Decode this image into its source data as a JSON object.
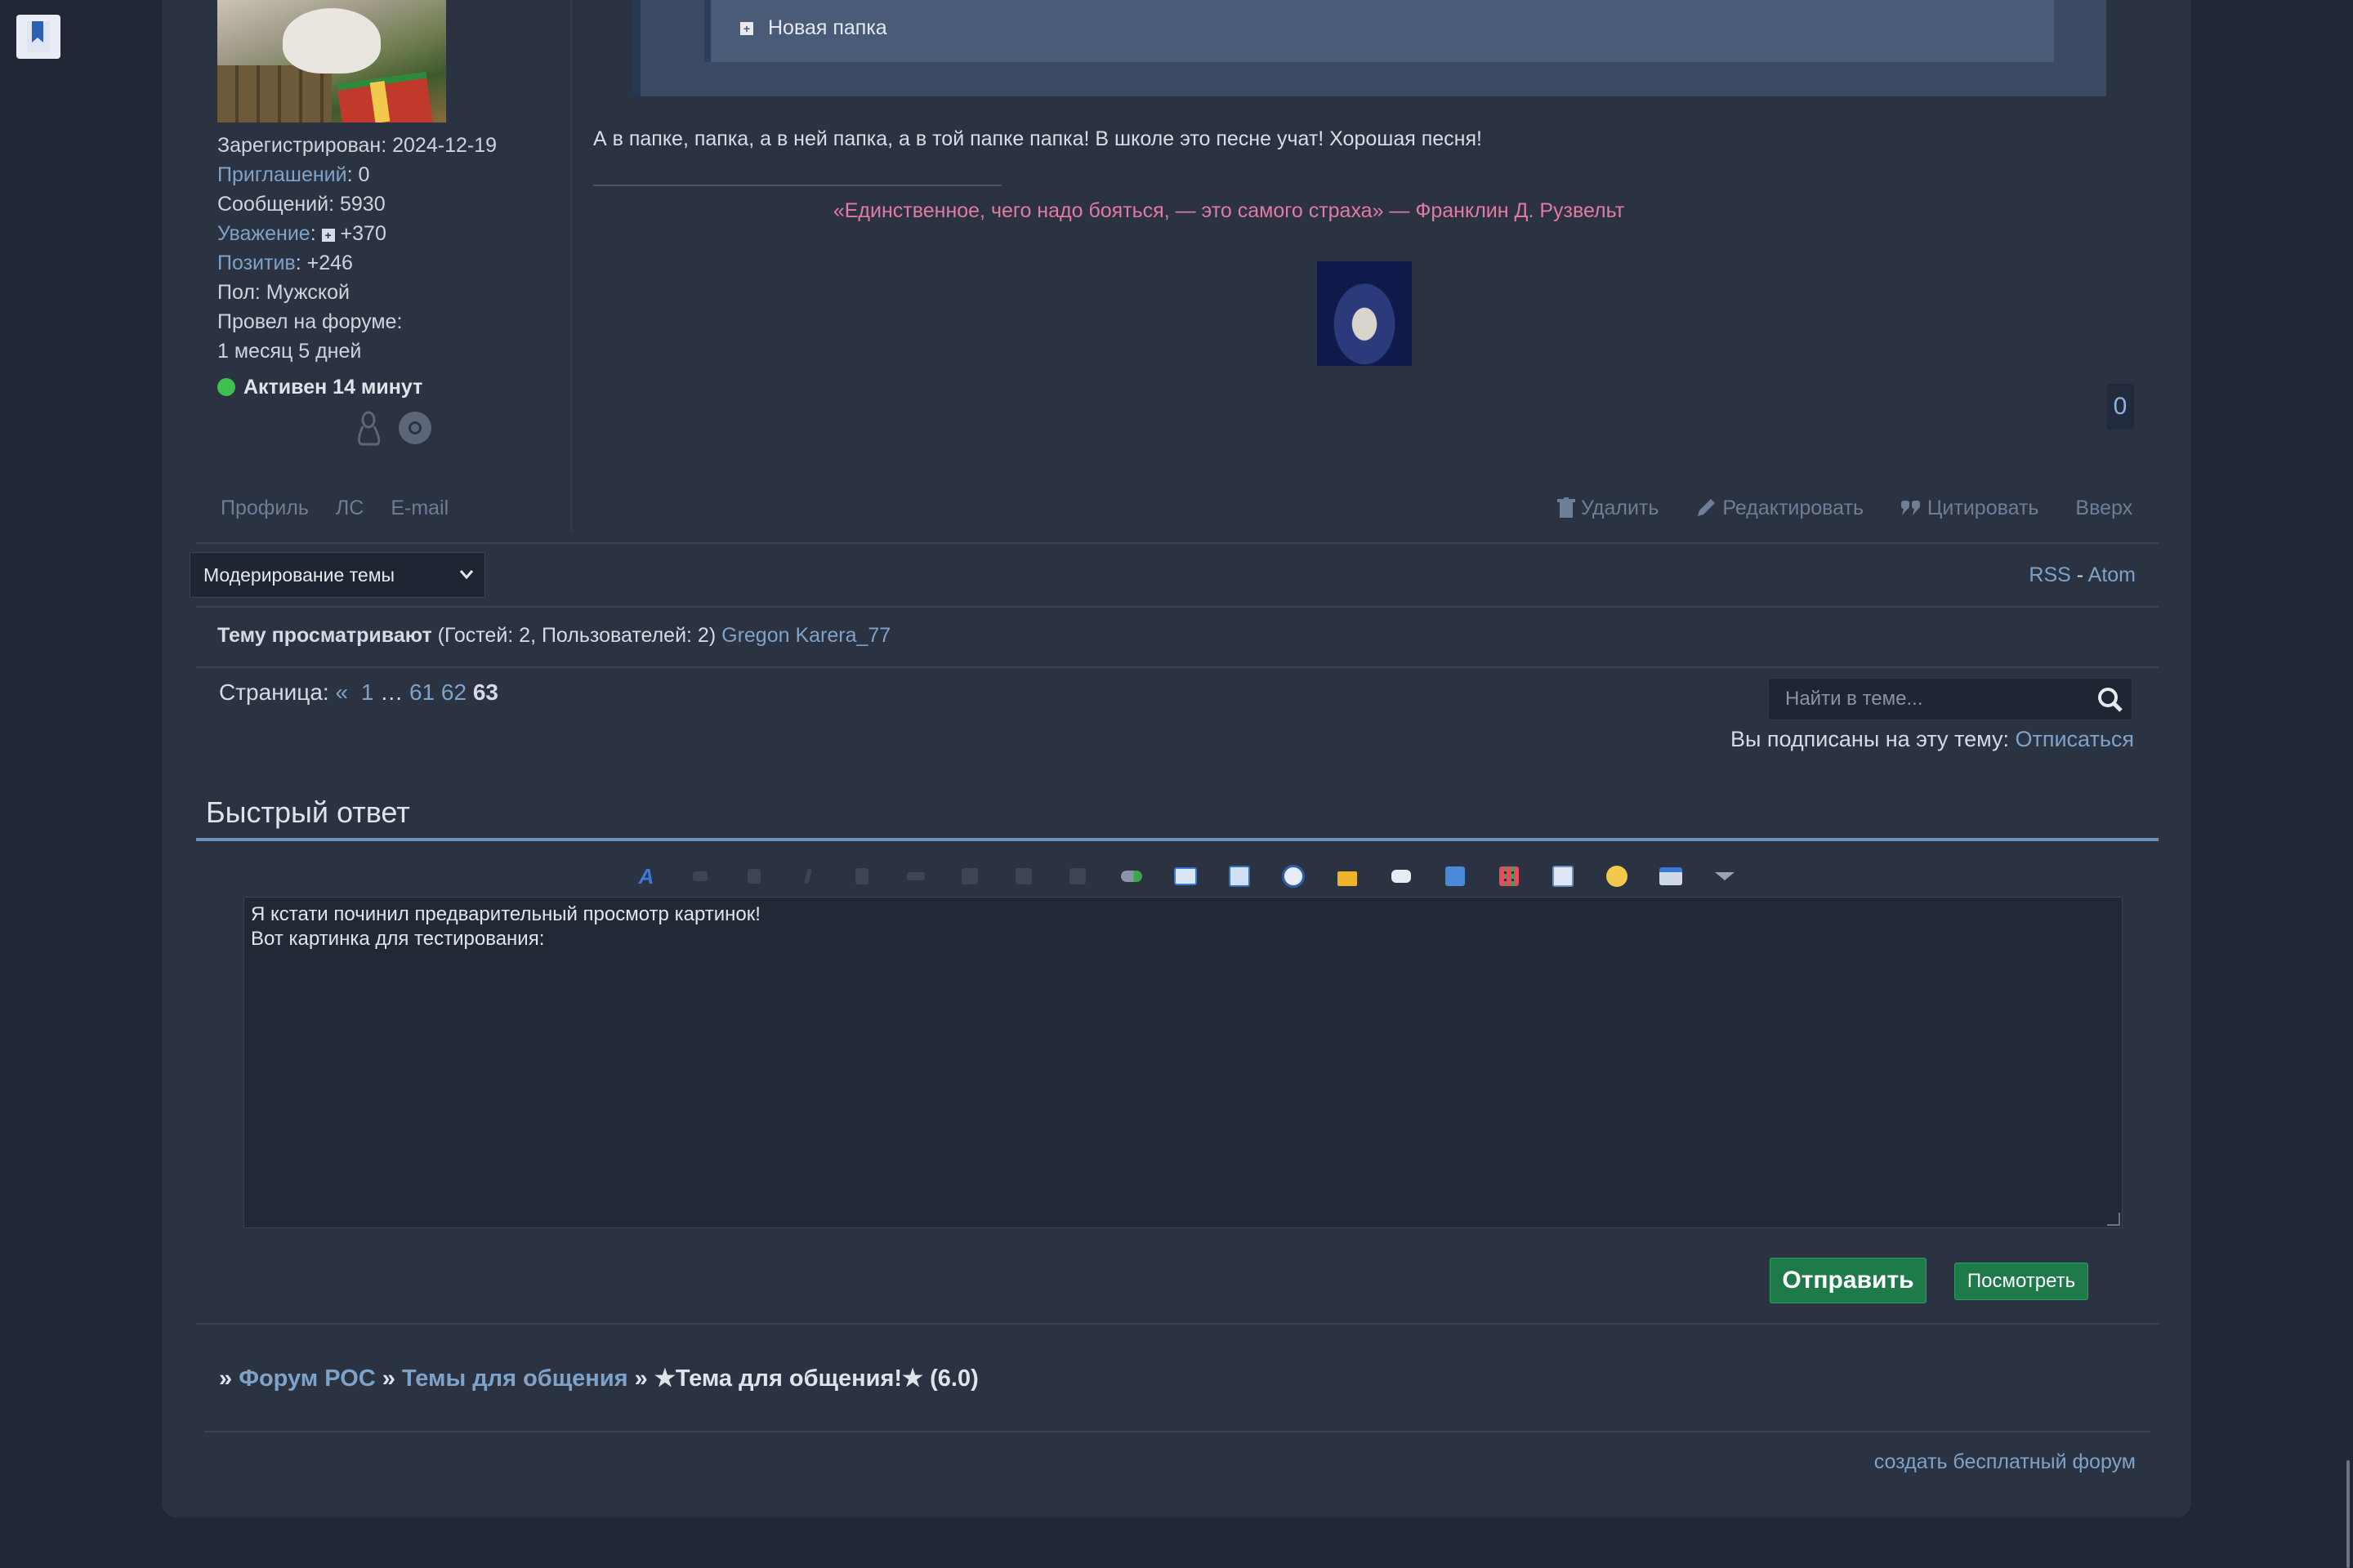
{
  "bookmark_icon": "bookmark-icon",
  "profile": {
    "registered": "Зарегистрирован: 2024-12-19",
    "invites_label": "Приглашений",
    "invites_value": ": 0",
    "messages": "Сообщений: 5930",
    "respect_label": "Уважение",
    "respect_value": "+370",
    "positive_label": "Позитив",
    "positive_value": ": +246",
    "gender": "Пол: Мужской",
    "time_on_forum_label": "Провел на форуме:",
    "time_on_forum_value": "1 месяц 5 дней",
    "status": "Активен 14 минут",
    "status_color": "#3fbf4f",
    "links": [
      "Профиль",
      "ЛС",
      "E-mail"
    ]
  },
  "post": {
    "folder_label": "Новая папка",
    "text": "А в папке, папка, а в ней папка, а в той папке папка! В школе это песне учат! Хорошая песня!",
    "signature_quote": "«Единственное, чего надо бояться, — это самого страха» — Франклин Д. Рузвельт",
    "reputation_count": "0",
    "actions": {
      "delete": "Удалить",
      "edit": "Редактировать",
      "quote": "Цитировать",
      "top": "Вверх"
    }
  },
  "moderation": {
    "select_value": "Модерирование темы",
    "rss": "RSS",
    "separator": " - ",
    "atom": "Atom"
  },
  "viewers": {
    "label": "Тему просматривают",
    "counts": " (Гостей: 2, Пользователей: 2) ",
    "users": "Gregon Karera_77"
  },
  "pagination": {
    "label": "Страница:",
    "prev": "«",
    "first": "1",
    "ellipsis": "…",
    "p61": "61",
    "p62": "62",
    "current": "63"
  },
  "search": {
    "placeholder": "Найти в теме..."
  },
  "subscription": {
    "text": "Вы подписаны на эту тему: ",
    "unsubscribe": "Отписаться"
  },
  "quick_reply": {
    "title": "Быстрый ответ",
    "toolbar": [
      "font-icon",
      "size-icon",
      "bold-icon",
      "italic-icon",
      "underline-icon",
      "strike-icon",
      "align-left-icon",
      "align-center-icon",
      "align-right-icon",
      "link-icon",
      "book-icon",
      "image-icon",
      "video-icon",
      "lock-icon",
      "quote-icon",
      "code-icon",
      "table-icon",
      "list-icon",
      "smile-icon",
      "upload-icon",
      "more-icon"
    ],
    "editor_text": "Я кстати починил предварительный просмотр картинок!\nВот картинка для тестирования:",
    "send_label": "Отправить",
    "preview_label": "Посмотреть"
  },
  "breadcrumbs": {
    "sep": "»",
    "forum": "Форум РОС",
    "section": "Темы для общения",
    "topic": "★Тема для общения!★ (6.0)"
  },
  "footer": {
    "create_forum": "создать бесплатный форум"
  }
}
